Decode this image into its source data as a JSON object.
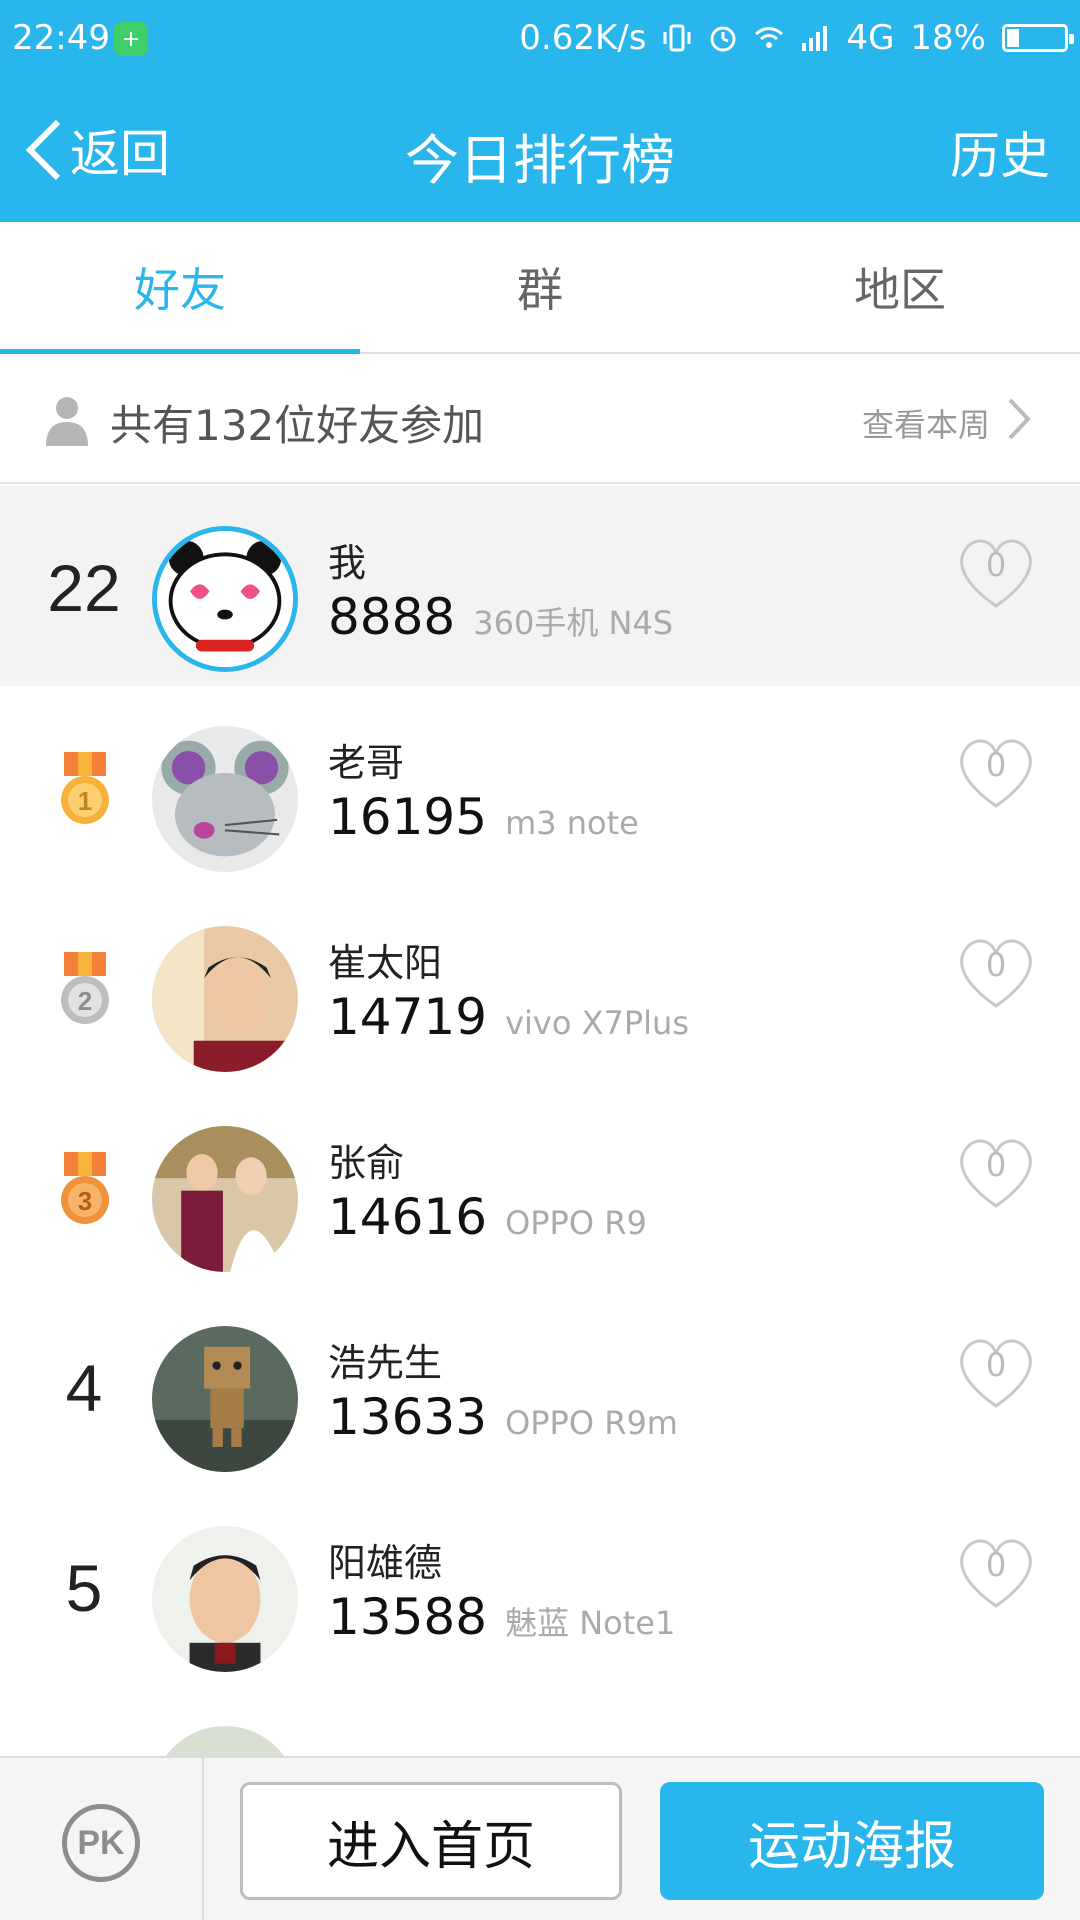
{
  "status_bar": {
    "time": "22:49",
    "net_speed": "0.62K/s",
    "network": "4G",
    "battery": "18%"
  },
  "title_bar": {
    "back_label": "返回",
    "title": "今日排行榜",
    "history_label": "历史"
  },
  "tabs": [
    {
      "label": "好友",
      "active": true
    },
    {
      "label": "群",
      "active": false
    },
    {
      "label": "地区",
      "active": false
    }
  ],
  "summary": {
    "text": "共有132位好友参加",
    "week_link": "查看本周"
  },
  "rows": [
    {
      "rank": "22",
      "name": "我",
      "steps": "8888",
      "device": "360手机 N4S",
      "likes": "0",
      "avatar": "panda-avatar",
      "me": true
    },
    {
      "rank": "1",
      "medal": "gold-medal-icon",
      "name": "老哥",
      "steps": "16195",
      "device": "m3 note",
      "likes": "0",
      "avatar": "mouse-avatar"
    },
    {
      "rank": "2",
      "medal": "silver-medal-icon",
      "name": "崔太阳",
      "steps": "14719",
      "device": "vivo X7Plus",
      "likes": "0",
      "avatar": "photo-avatar"
    },
    {
      "rank": "3",
      "medal": "bronze-medal-icon",
      "name": "张俞",
      "steps": "14616",
      "device": "OPPO R9",
      "likes": "0",
      "avatar": "wedding-avatar"
    },
    {
      "rank": "4",
      "name": "浩先生",
      "steps": "13633",
      "device": "OPPO R9m",
      "likes": "0",
      "avatar": "danbo-avatar"
    },
    {
      "rank": "5",
      "name": "阳雄德",
      "steps": "13588",
      "device": "魅蓝 Note1",
      "likes": "0",
      "avatar": "photo-avatar"
    }
  ],
  "bottom_bar": {
    "pk_label": "PK",
    "home_button": "进入首页",
    "poster_button": "运动海报"
  },
  "colors": {
    "accent": "#29b6ec",
    "gold": "#f5b13a",
    "silver": "#bdbdbd",
    "bronze": "#f0923a"
  }
}
